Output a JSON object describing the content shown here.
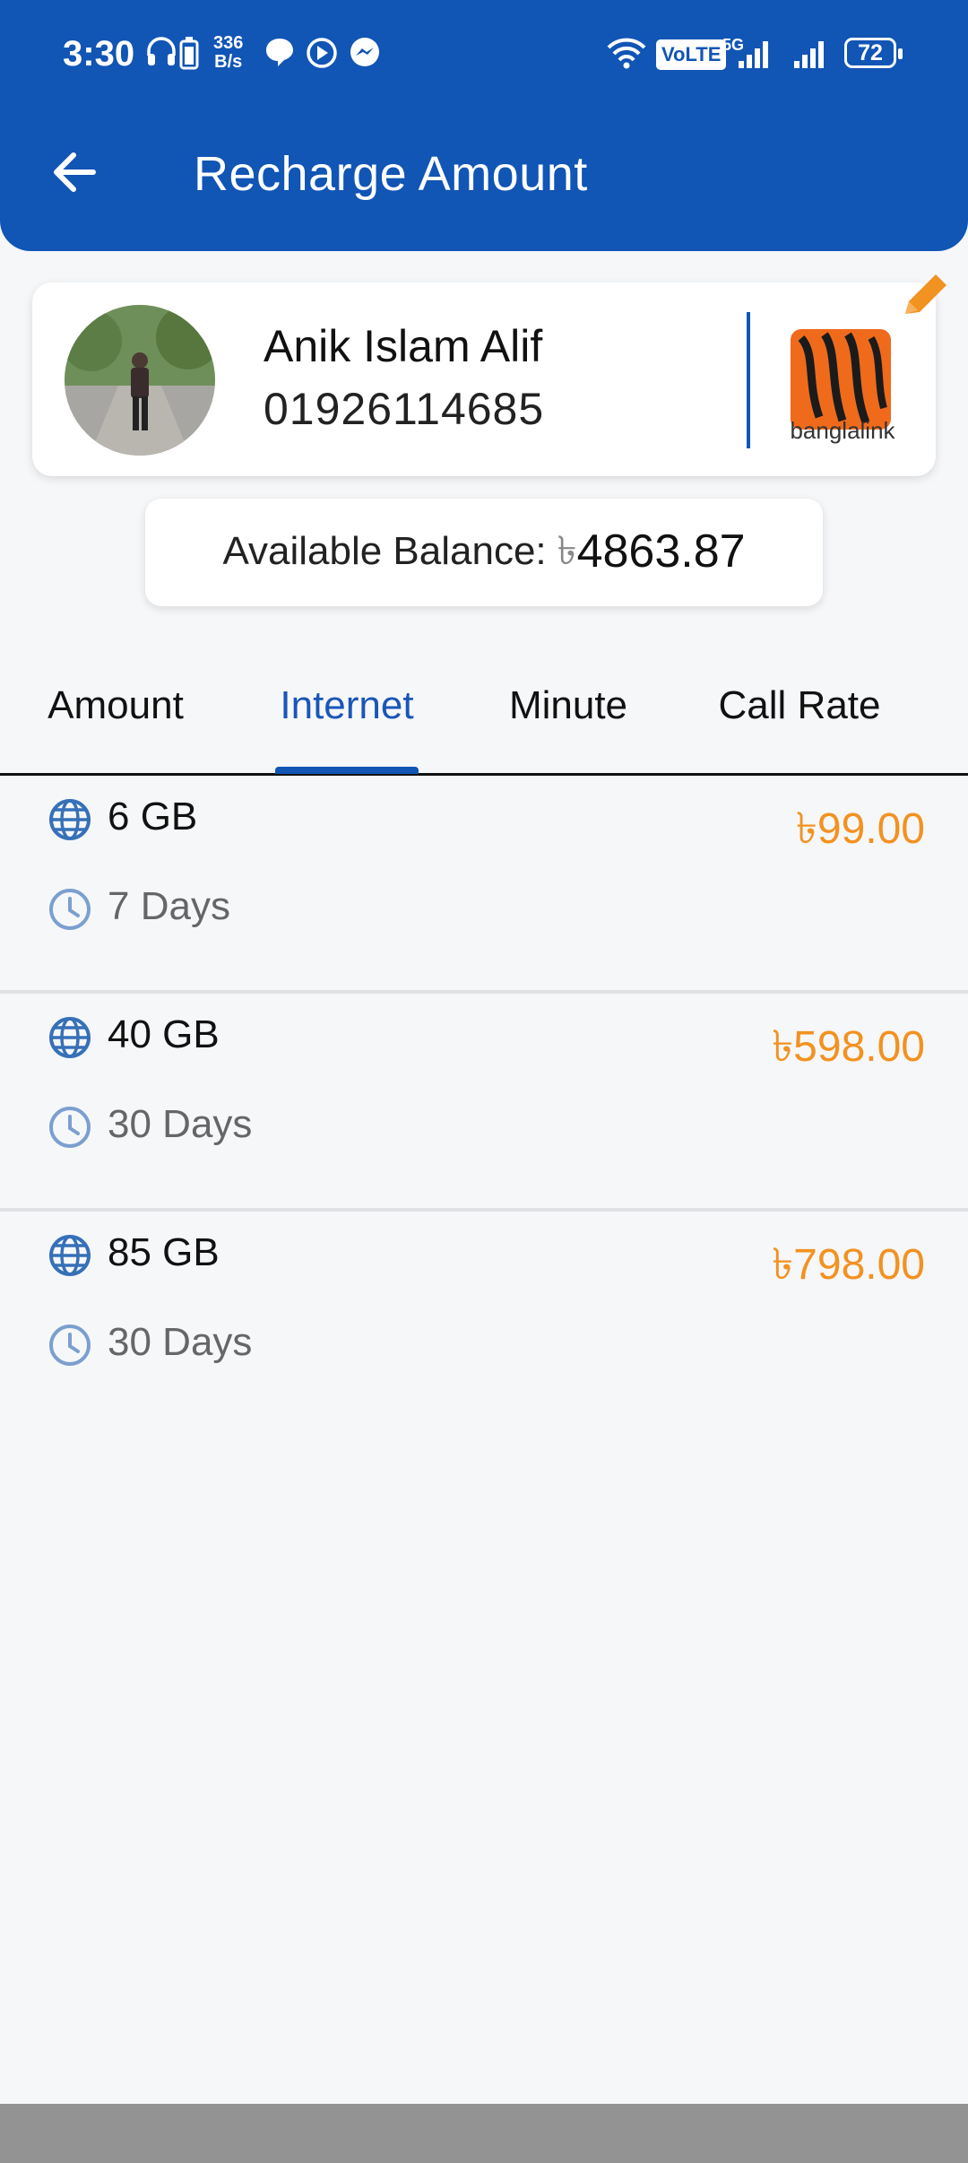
{
  "status_bar": {
    "time": "3:30",
    "speed_value": "336",
    "speed_unit": "B/s",
    "volte": "VoLTE",
    "network": "5G",
    "battery": "72"
  },
  "header": {
    "title": "Recharge Amount"
  },
  "contact": {
    "name": "Anik Islam Alif",
    "phone": "01926114685",
    "operator": "banglalink"
  },
  "balance": {
    "label": "Available Balance:",
    "currency": "৳",
    "value": "4863.87"
  },
  "tabs": [
    {
      "label": "Amount"
    },
    {
      "label": "Internet"
    },
    {
      "label": "Minute"
    },
    {
      "label": "Call Rate"
    }
  ],
  "packages": [
    {
      "data": "6 GB",
      "validity": "7 Days",
      "price": "৳99.00"
    },
    {
      "data": "40 GB",
      "validity": "30 Days",
      "price": "৳598.00"
    },
    {
      "data": "85 GB",
      "validity": "30 Days",
      "price": "৳798.00"
    }
  ],
  "colors": {
    "primary": "#1155b5",
    "price": "#f29221",
    "operator_orange": "#f06a1c"
  }
}
